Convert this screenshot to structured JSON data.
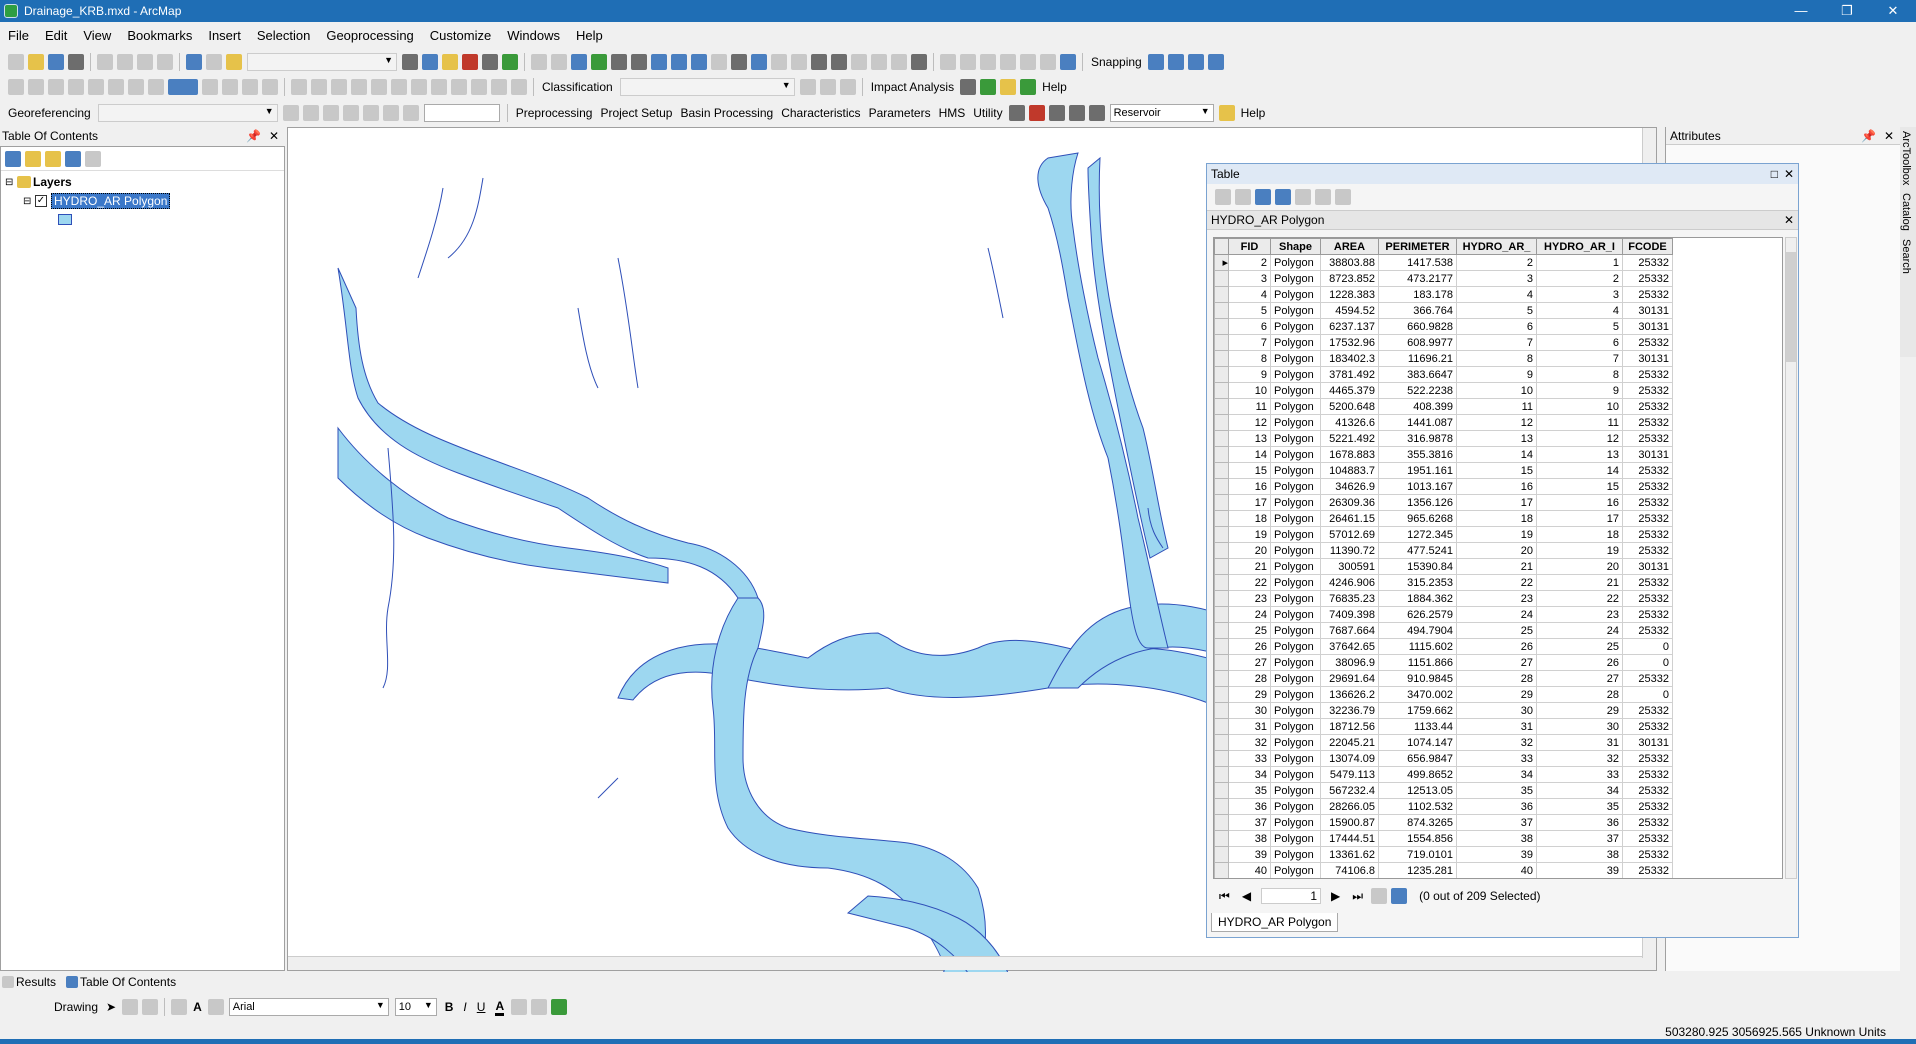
{
  "window": {
    "title": "Drainage_KRB.mxd - ArcMap"
  },
  "menu": [
    "File",
    "Edit",
    "View",
    "Bookmarks",
    "Insert",
    "Selection",
    "Geoprocessing",
    "Customize",
    "Windows",
    "Help"
  ],
  "toolbar": {
    "snapping_label": "Snapping",
    "classification_label": "Classification",
    "impact_analysis_label": "Impact Analysis",
    "help_label": "Help",
    "georeferencing_label": "Georeferencing",
    "hydro_menus": [
      "Preprocessing",
      "Project Setup",
      "Basin Processing",
      "Characteristics",
      "Parameters",
      "HMS",
      "Utility"
    ],
    "reservoir_value": "Reservoir",
    "help2_label": "Help"
  },
  "toc": {
    "title": "Table Of Contents",
    "layers_label": "Layers",
    "layer_name": "HYDRO_AR Polygon"
  },
  "attributes_panel": {
    "title": "Attributes",
    "side_tabs": [
      "ArcToolbox",
      "Catalog",
      "Search"
    ]
  },
  "table": {
    "window_title": "Table",
    "layer_title": "HYDRO_AR Polygon",
    "columns": [
      "FID",
      "Shape",
      "AREA",
      "PERIMETER",
      "HYDRO_AR_",
      "HYDRO_AR_I",
      "FCODE"
    ],
    "rows": [
      [
        "2",
        "Polygon",
        "38803.88",
        "1417.538",
        "2",
        "1",
        "25332"
      ],
      [
        "3",
        "Polygon",
        "8723.852",
        "473.2177",
        "3",
        "2",
        "25332"
      ],
      [
        "4",
        "Polygon",
        "1228.383",
        "183.178",
        "4",
        "3",
        "25332"
      ],
      [
        "5",
        "Polygon",
        "4594.52",
        "366.764",
        "5",
        "4",
        "30131"
      ],
      [
        "6",
        "Polygon",
        "6237.137",
        "660.9828",
        "6",
        "5",
        "30131"
      ],
      [
        "7",
        "Polygon",
        "17532.96",
        "608.9977",
        "7",
        "6",
        "25332"
      ],
      [
        "8",
        "Polygon",
        "183402.3",
        "11696.21",
        "8",
        "7",
        "30131"
      ],
      [
        "9",
        "Polygon",
        "3781.492",
        "383.6647",
        "9",
        "8",
        "25332"
      ],
      [
        "10",
        "Polygon",
        "4465.379",
        "522.2238",
        "10",
        "9",
        "25332"
      ],
      [
        "11",
        "Polygon",
        "5200.648",
        "408.399",
        "11",
        "10",
        "25332"
      ],
      [
        "12",
        "Polygon",
        "41326.6",
        "1441.087",
        "12",
        "11",
        "25332"
      ],
      [
        "13",
        "Polygon",
        "5221.492",
        "316.9878",
        "13",
        "12",
        "25332"
      ],
      [
        "14",
        "Polygon",
        "1678.883",
        "355.3816",
        "14",
        "13",
        "30131"
      ],
      [
        "15",
        "Polygon",
        "104883.7",
        "1951.161",
        "15",
        "14",
        "25332"
      ],
      [
        "16",
        "Polygon",
        "34626.9",
        "1013.167",
        "16",
        "15",
        "25332"
      ],
      [
        "17",
        "Polygon",
        "26309.36",
        "1356.126",
        "17",
        "16",
        "25332"
      ],
      [
        "18",
        "Polygon",
        "26461.15",
        "965.6268",
        "18",
        "17",
        "25332"
      ],
      [
        "19",
        "Polygon",
        "57012.69",
        "1272.345",
        "19",
        "18",
        "25332"
      ],
      [
        "20",
        "Polygon",
        "11390.72",
        "477.5241",
        "20",
        "19",
        "25332"
      ],
      [
        "21",
        "Polygon",
        "300591",
        "15390.84",
        "21",
        "20",
        "30131"
      ],
      [
        "22",
        "Polygon",
        "4246.906",
        "315.2353",
        "22",
        "21",
        "25332"
      ],
      [
        "23",
        "Polygon",
        "76835.23",
        "1884.362",
        "23",
        "22",
        "25332"
      ],
      [
        "24",
        "Polygon",
        "7409.398",
        "626.2579",
        "24",
        "23",
        "25332"
      ],
      [
        "25",
        "Polygon",
        "7687.664",
        "494.7904",
        "25",
        "24",
        "25332"
      ],
      [
        "26",
        "Polygon",
        "37642.65",
        "1115.602",
        "26",
        "25",
        "0"
      ],
      [
        "27",
        "Polygon",
        "38096.9",
        "1151.866",
        "27",
        "26",
        "0"
      ],
      [
        "28",
        "Polygon",
        "29691.64",
        "910.9845",
        "28",
        "27",
        "25332"
      ],
      [
        "29",
        "Polygon",
        "136626.2",
        "3470.002",
        "29",
        "28",
        "0"
      ],
      [
        "30",
        "Polygon",
        "32236.79",
        "1759.662",
        "30",
        "29",
        "25332"
      ],
      [
        "31",
        "Polygon",
        "18712.56",
        "1133.44",
        "31",
        "30",
        "25332"
      ],
      [
        "32",
        "Polygon",
        "22045.21",
        "1074.147",
        "32",
        "31",
        "30131"
      ],
      [
        "33",
        "Polygon",
        "13074.09",
        "656.9847",
        "33",
        "32",
        "25332"
      ],
      [
        "34",
        "Polygon",
        "5479.113",
        "499.8652",
        "34",
        "33",
        "25332"
      ],
      [
        "35",
        "Polygon",
        "567232.4",
        "12513.05",
        "35",
        "34",
        "25332"
      ],
      [
        "36",
        "Polygon",
        "28266.05",
        "1102.532",
        "36",
        "35",
        "25332"
      ],
      [
        "37",
        "Polygon",
        "15900.87",
        "874.3265",
        "37",
        "36",
        "25332"
      ],
      [
        "38",
        "Polygon",
        "17444.51",
        "1554.856",
        "38",
        "37",
        "25332"
      ],
      [
        "39",
        "Polygon",
        "13361.62",
        "719.0101",
        "39",
        "38",
        "25332"
      ],
      [
        "40",
        "Polygon",
        "74106.8",
        "1235.281",
        "40",
        "39",
        "25332"
      ]
    ],
    "page_number": "1",
    "selection_status": "(0 out of 209 Selected)",
    "bottom_tab": "HYDRO_AR Polygon"
  },
  "bottom_tabs": [
    "Results",
    "Table Of Contents"
  ],
  "drawing": {
    "drawing_label": "Drawing",
    "font_name": "Arial",
    "font_size": "10"
  },
  "status": {
    "coordinates": "503280.925  3056925.565 Unknown Units"
  },
  "colors": {
    "water_fill": "#9dd7f0",
    "water_stroke": "#2f4fb8",
    "titlebar": "#1f6eb5"
  }
}
